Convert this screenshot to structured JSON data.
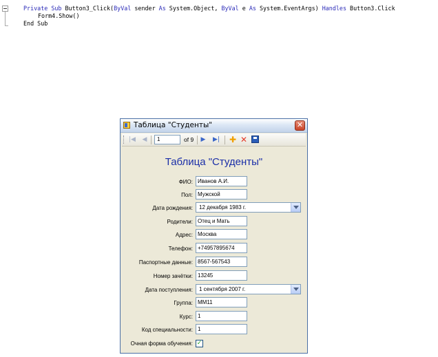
{
  "code": {
    "line1": {
      "kw1": "Private Sub",
      "t1": " Button3_Click(",
      "kw2": "ByVal",
      "t2": " sender ",
      "kw3": "As",
      "t3": " System.Object, ",
      "kw4": "ByVal",
      "t4": " e ",
      "kw5": "As",
      "t5": " System.EventArgs) ",
      "kw6": "Handles",
      "t6": " Button3.Click"
    },
    "line2": "Form4.Show()",
    "line3": "End Sub"
  },
  "window": {
    "title": "Таблица \"Студенты\"",
    "close_glyph": "✕"
  },
  "navigator": {
    "position": "1",
    "count_label": "of 9",
    "icons": [
      "move-first-icon",
      "move-previous-icon",
      "move-next-icon",
      "move-last-icon",
      "add-new-icon",
      "delete-icon",
      "save-icon"
    ]
  },
  "form": {
    "heading": "Таблица \"Студенты\"",
    "fields": {
      "fio": {
        "label": "ФИО:",
        "value": "Иванов А.И."
      },
      "gender": {
        "label": "Пол:",
        "value": "Мужской"
      },
      "birth": {
        "label": "Дата рождения:",
        "value": "12  декабря  1983 г."
      },
      "parents": {
        "label": "Родители:",
        "value": "Отец и Мать"
      },
      "address": {
        "label": "Адрес:",
        "value": "Москва"
      },
      "phone": {
        "label": "Телефон:",
        "value": "+74957895674"
      },
      "passport": {
        "label": "Паспортные данные:",
        "value": "8567-567543"
      },
      "record": {
        "label": "Номер зачётки:",
        "value": "13245"
      },
      "admission": {
        "label": "Дата поступления:",
        "value": " 1  сентября 2007 г."
      },
      "group": {
        "label": "Группа:",
        "value": "ММ11"
      },
      "course": {
        "label": "Курс:",
        "value": "1"
      },
      "specialty": {
        "label": "Код специальности:",
        "value": "1"
      },
      "fulltime": {
        "label": "Очная форма обучения:",
        "checked": true
      }
    }
  },
  "colors": {
    "keyword": "#2a2ab8",
    "heading": "#1a2ea8",
    "window_bg": "#ece9d8",
    "checkbox_mark": "#21a121"
  }
}
